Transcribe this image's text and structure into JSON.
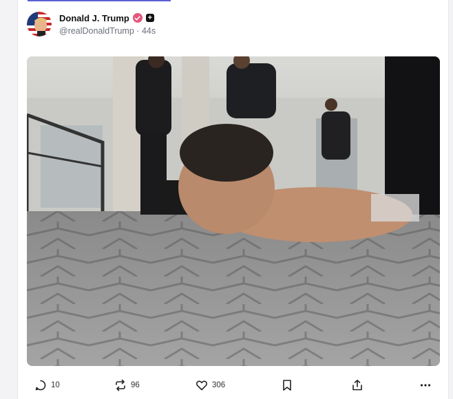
{
  "post": {
    "display_name": "Donald J. Trump",
    "handle": "@realDonaldTrump",
    "separator": "·",
    "time_ago": "44s",
    "plus_symbol": "+"
  },
  "actions": {
    "replies": "10",
    "reposts": "96",
    "likes": "306"
  },
  "icons": {
    "verified": "verified-badge-icon",
    "reply": "speech-bubble-icon",
    "repost": "repost-arrows-icon",
    "like": "heart-icon",
    "bookmark": "bookmark-icon",
    "share": "share-upload-icon",
    "more": "ellipsis-icon"
  },
  "colors": {
    "verified_badge": "#e4577c",
    "accent_bar": "#5a5fd6"
  }
}
